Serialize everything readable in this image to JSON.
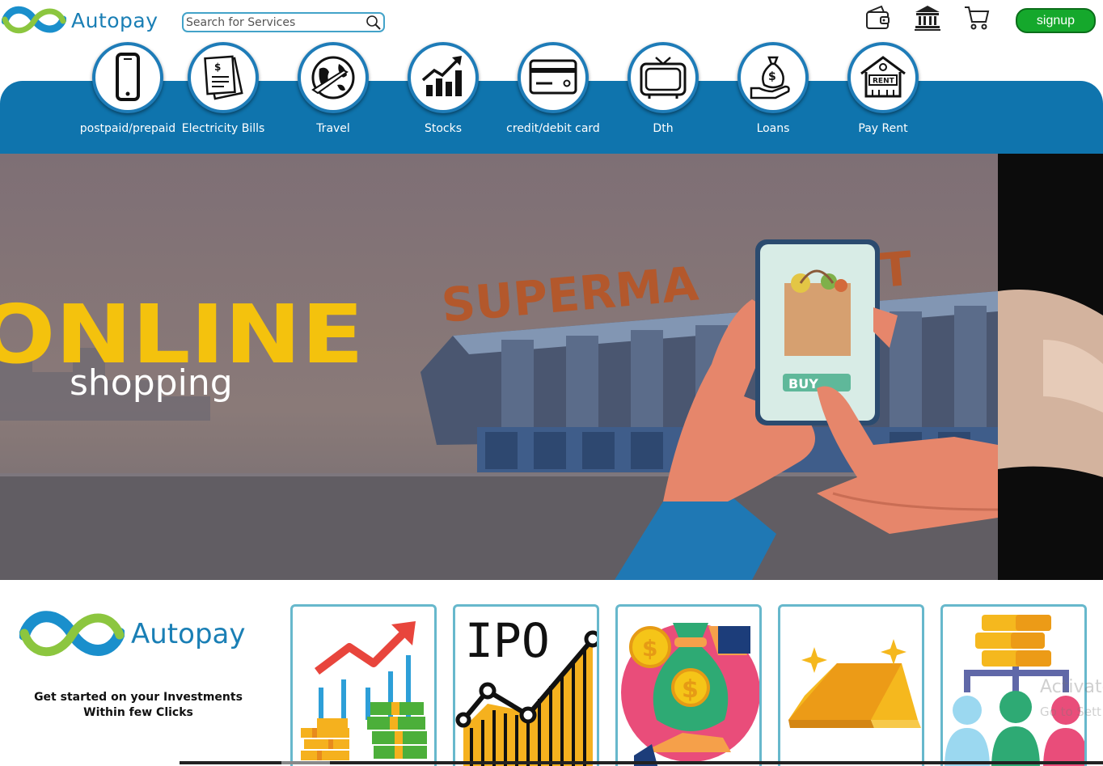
{
  "brand": {
    "name": "Autopay"
  },
  "search": {
    "placeholder": "Search for Services"
  },
  "header": {
    "signup_label": "signup"
  },
  "services": [
    {
      "label": "postpaid/prepaid",
      "icon": "phone-icon"
    },
    {
      "label": "Electricity Bills",
      "icon": "bill-icon"
    },
    {
      "label": "Travel",
      "icon": "globe-plane-icon"
    },
    {
      "label": "Stocks",
      "icon": "stocks-chart-icon"
    },
    {
      "label": "credit/debit card",
      "icon": "card-icon"
    },
    {
      "label": "Dth",
      "icon": "tv-icon"
    },
    {
      "label": "Loans",
      "icon": "money-bag-hand-icon"
    },
    {
      "label": "Pay Rent",
      "icon": "rent-house-icon"
    }
  ],
  "hero": {
    "title": "ONLINE",
    "subtitle": "shopping",
    "sign": "SUPERMA",
    "sign_end": "T",
    "button": "BUY"
  },
  "investments": {
    "tagline_line1": "Get started on your Investments",
    "tagline_line2": "Within few Clicks",
    "cards": [
      {
        "icon": "growth-money-icon"
      },
      {
        "icon": "ipo-chart-icon",
        "text": "IPO"
      },
      {
        "icon": "money-bag-icon"
      },
      {
        "icon": "gold-bar-icon"
      },
      {
        "icon": "coins-people-icon"
      }
    ]
  },
  "watermark": {
    "line1": "Activate",
    "line2": "Go to Sett"
  },
  "colors": {
    "brand_blue": "#0f74ad",
    "signup_green": "#15a82c",
    "card_border": "#67b8cc"
  }
}
